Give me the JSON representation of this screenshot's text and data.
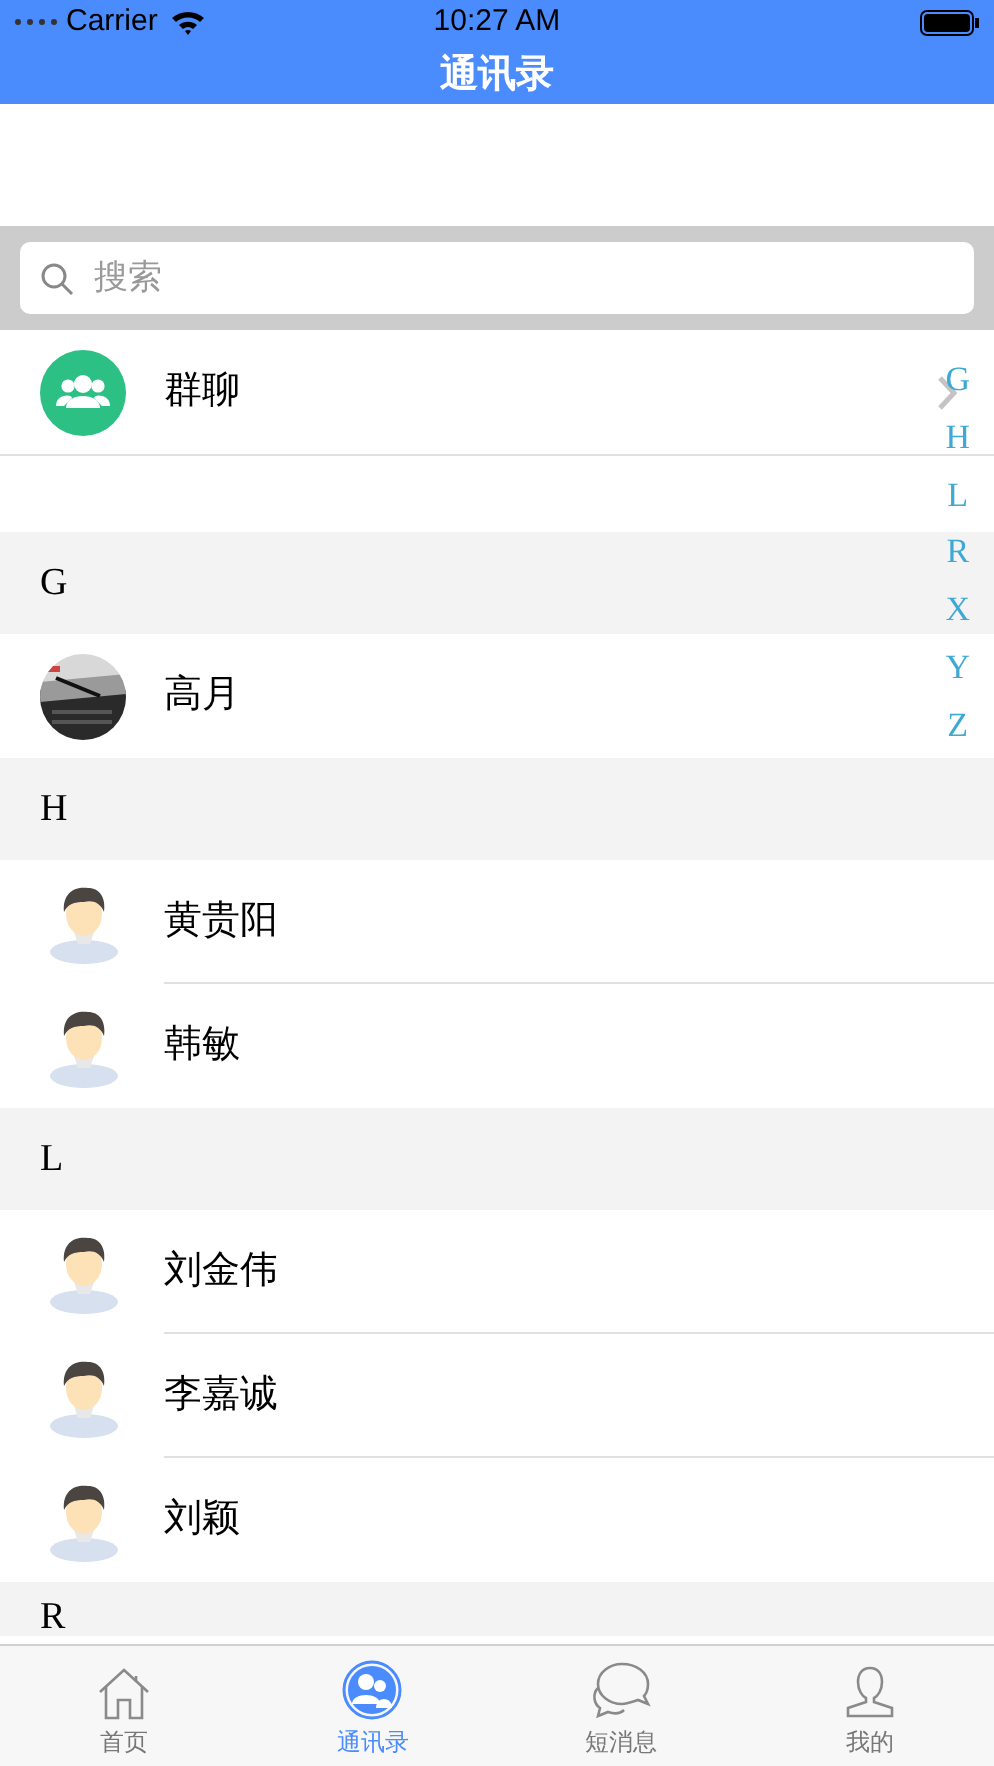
{
  "status_bar": {
    "carrier": "Carrier",
    "time": "10:27 AM"
  },
  "nav_title": "通讯录",
  "search": {
    "placeholder": "搜索"
  },
  "group_chat": {
    "label": "群聊"
  },
  "sections": [
    {
      "letter": "G",
      "contacts": [
        {
          "name": "高月",
          "kind": "picture"
        }
      ]
    },
    {
      "letter": "H",
      "contacts": [
        {
          "name": "黄贵阳",
          "kind": "default"
        },
        {
          "name": "韩敏",
          "kind": "default"
        }
      ]
    },
    {
      "letter": "L",
      "contacts": [
        {
          "name": "刘金伟",
          "kind": "default"
        },
        {
          "name": "李嘉诚",
          "kind": "default"
        },
        {
          "name": "刘颖",
          "kind": "default"
        }
      ]
    },
    {
      "letter": "R"
    }
  ],
  "index": [
    "G",
    "H",
    "L",
    "R",
    "X",
    "Y",
    "Z"
  ],
  "tabs": [
    {
      "label": "首页",
      "kind": "home",
      "selected": false
    },
    {
      "label": "通讯录",
      "kind": "contacts",
      "selected": true
    },
    {
      "label": "短消息",
      "kind": "messages",
      "selected": false
    },
    {
      "label": "我的",
      "kind": "profile",
      "selected": false
    }
  ]
}
